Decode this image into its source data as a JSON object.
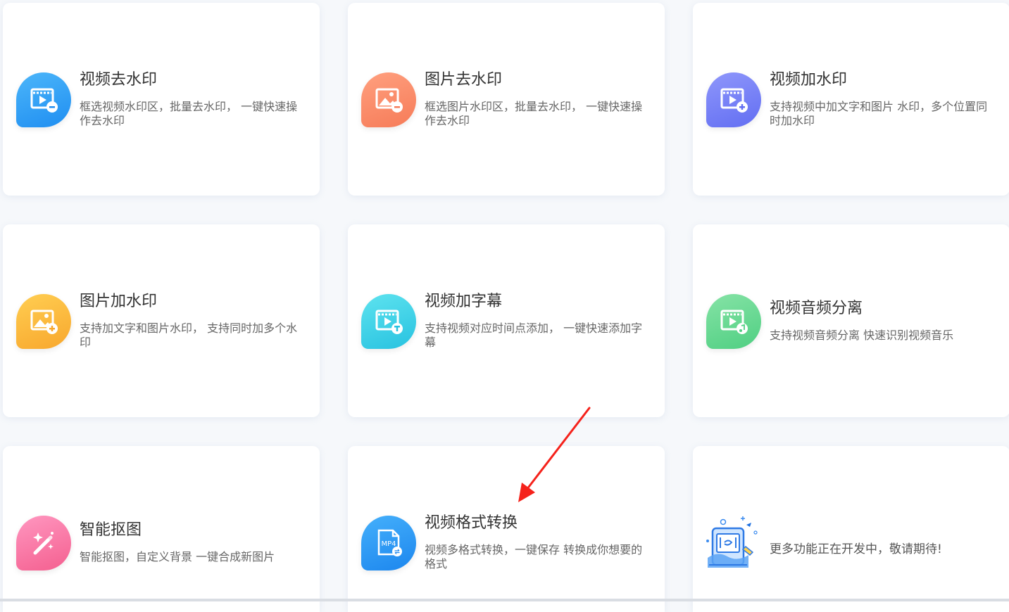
{
  "cards": [
    {
      "id": "video-remove-watermark",
      "title": "视频去水印",
      "desc": "框选视频水印区，批量去水印， 一键快速操作去水印",
      "icon": "video-minus-icon",
      "gradient": [
        "#4cb6fa",
        "#1f8ef1"
      ]
    },
    {
      "id": "image-remove-watermark",
      "title": "图片去水印",
      "desc": "框选图片水印区，批量去水印， 一键快速操作去水印",
      "icon": "image-minus-icon",
      "gradient": [
        "#ffa07f",
        "#f67b58"
      ]
    },
    {
      "id": "video-add-watermark",
      "title": "视频加水印",
      "desc": "支持视频中加文字和图片 水印，多个位置同时加水印",
      "icon": "video-plus-icon",
      "gradient": [
        "#8f97fb",
        "#626ef2"
      ]
    },
    {
      "id": "image-add-watermark",
      "title": "图片加水印",
      "desc": "支持加文字和图片水印， 支持同时加多个水印",
      "icon": "image-plus-icon",
      "gradient": [
        "#ffce52",
        "#f8a72d"
      ]
    },
    {
      "id": "video-add-subtitle",
      "title": "视频加字幕",
      "desc": "支持视频对应时间点添加， 一键快速添加字幕",
      "icon": "video-text-icon",
      "gradient": [
        "#5ee3ef",
        "#27c2e0"
      ]
    },
    {
      "id": "video-audio-separate",
      "title": "视频音频分离",
      "desc": "支持视频音频分离 快速识别视频音乐",
      "icon": "video-music-icon",
      "gradient": [
        "#86e3a6",
        "#4fcf82"
      ]
    },
    {
      "id": "smart-cutout",
      "title": "智能抠图",
      "desc": "智能抠图，自定义背景 一键合成新图片",
      "icon": "magic-wand-icon",
      "gradient": [
        "#ff97c0",
        "#f45f8f"
      ]
    },
    {
      "id": "video-format-convert",
      "title": "视频格式转换",
      "desc": "视频多格式转换，一键保存 转换成你想要的格式",
      "icon": "mp4-file-icon",
      "gradient": [
        "#45b0fb",
        "#1c86ee"
      ],
      "badge": "MP4"
    }
  ],
  "more": {
    "text": "更多功能正在开发中，敬请期待!",
    "icon": "under-construction-illustration"
  },
  "annotation": {
    "color": "#f5221b"
  }
}
